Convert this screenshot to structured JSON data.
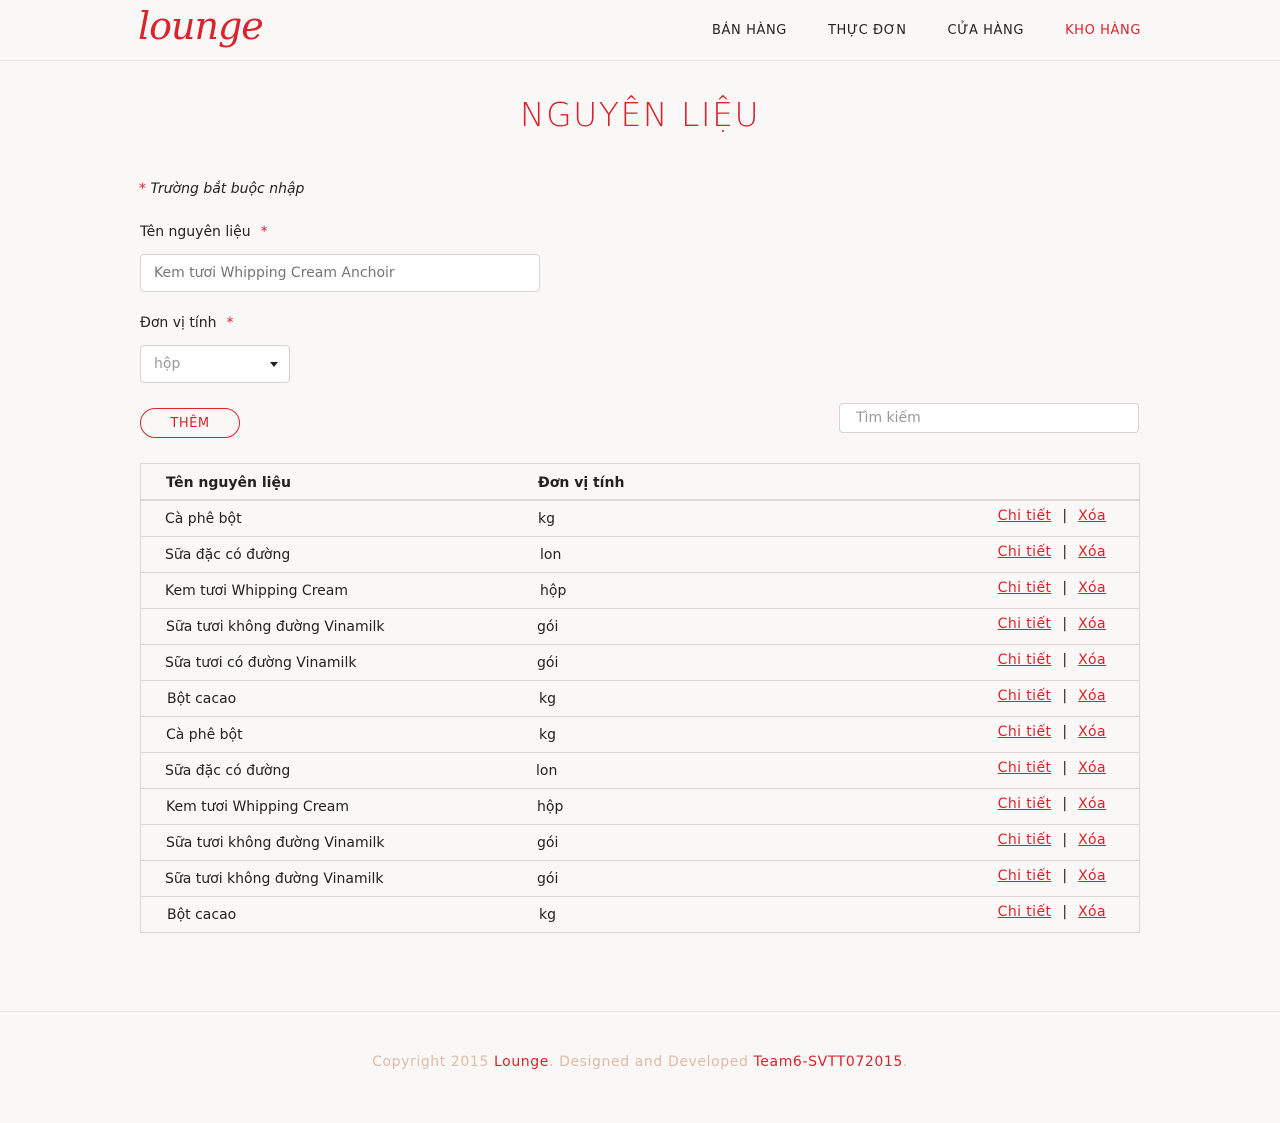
{
  "header": {
    "logo": "lounge",
    "nav": [
      {
        "label": "BÁN HÀNG"
      },
      {
        "label": "THỰC ĐƠN"
      },
      {
        "label": "CỬA HÀNG"
      },
      {
        "label": "KHO HÀNG"
      }
    ]
  },
  "page": {
    "title": "NGUYÊN LIỆU",
    "required_star": "*",
    "required_note": "Trường bắt buộc nhập"
  },
  "form": {
    "name_label": "Tên nguyên liệu",
    "name_placeholder": "Kem tươi Whipping Cream Anchoir",
    "unit_label": "Đơn vị tính",
    "unit_selected": "hộp",
    "add_button": "THÊM",
    "search_placeholder": "Tìm kiếm"
  },
  "table": {
    "headers": {
      "name": "Tên nguyên liệu",
      "unit": "Đơn vị tính"
    },
    "action_detail": "Chi tiết",
    "action_separator": "|",
    "action_delete": "Xóa",
    "rows": [
      {
        "name": "Cà phê bột",
        "unit": "kg"
      },
      {
        "name": "Sữa đặc có đường",
        "unit": "lon"
      },
      {
        "name": "Kem tươi Whipping Cream",
        "unit": "hộp"
      },
      {
        "name": "Sữa tươi không đường Vinamilk",
        "unit": "gói"
      },
      {
        "name": "Sữa tươi có đường Vinamilk",
        "unit": "gói"
      },
      {
        "name": "Bột cacao",
        "unit": "kg"
      },
      {
        "name": "Cà phê bột",
        "unit": "kg"
      },
      {
        "name": "Sữa đặc có đường",
        "unit": "lon"
      },
      {
        "name": "Kem tươi Whipping Cream",
        "unit": "hộp"
      },
      {
        "name": "Sữa tươi không đường Vinamilk",
        "unit": "gói"
      },
      {
        "name": "Sữa tươi không đường Vinamilk",
        "unit": "gói"
      },
      {
        "name": "Bột cacao",
        "unit": "kg"
      }
    ]
  },
  "footer": {
    "copyright": "Copyright 2015 ",
    "brand": "Lounge",
    "designed": ". Designed and Developed ",
    "team": "Team6-SVTT072015",
    "end": "."
  },
  "colors": {
    "accent": "#d9232d",
    "background": "#faf8f6",
    "footer_text": "#e0b9a8"
  }
}
